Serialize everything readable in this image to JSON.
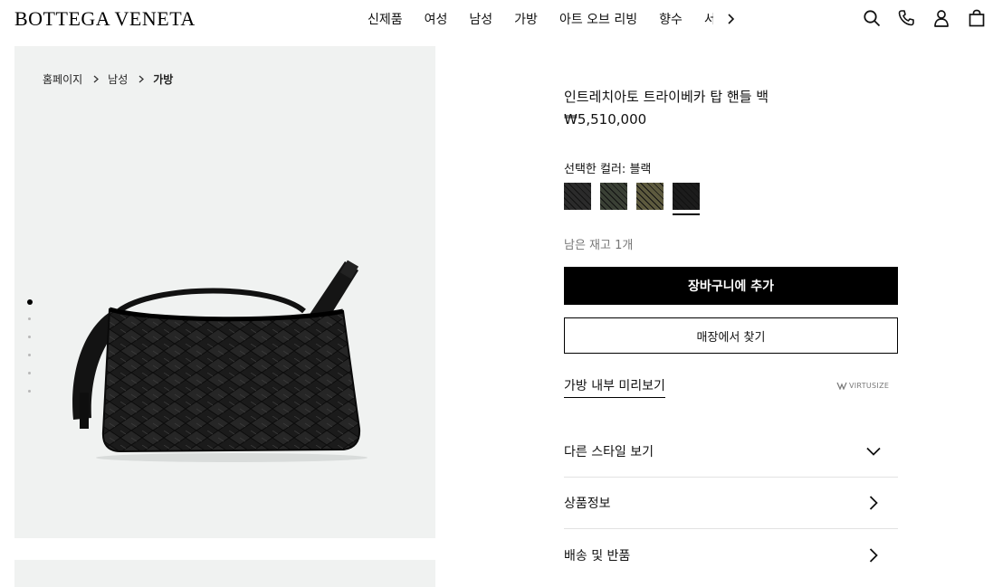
{
  "header": {
    "logo": "BOTTEGA VENETA",
    "nav": [
      "신제품",
      "여성",
      "남성",
      "가방",
      "아트 오브 리빙",
      "향수"
    ],
    "nav_clipped": "서",
    "icons": [
      "search-icon",
      "phone-icon",
      "user-icon",
      "shopping-bag-icon"
    ]
  },
  "breadcrumb": {
    "items": [
      "홈페이지",
      "남성"
    ],
    "current": "가방"
  },
  "gallery": {
    "slides": [
      true,
      false,
      false,
      false,
      false,
      false
    ]
  },
  "product": {
    "name": "인트레치아토 트라이베카 탑 핸들 백",
    "price": "₩5,510,000",
    "color_label": "선택한 컬러: 블랙",
    "swatches": [
      {
        "color": "#2b2b2b",
        "selected": false
      },
      {
        "color": "#3a4035",
        "selected": false
      },
      {
        "color": "#5d5a3e",
        "selected": false
      },
      {
        "color": "#1c1c1c",
        "selected": true
      }
    ],
    "stock": "남은 재고 1개",
    "add_to_cart": "장바구니에 추가",
    "find_in_store": "매장에서 찾기",
    "preview_link": "가방 내부 미리보기",
    "virtusize": "VIRTUSIZE"
  },
  "accordion": [
    {
      "label": "다른 스타일 보기",
      "icon": "chevron-down-icon"
    },
    {
      "label": "상품정보",
      "icon": "chevron-right-icon"
    },
    {
      "label": "배송 및 반품",
      "icon": "chevron-right-icon"
    }
  ]
}
